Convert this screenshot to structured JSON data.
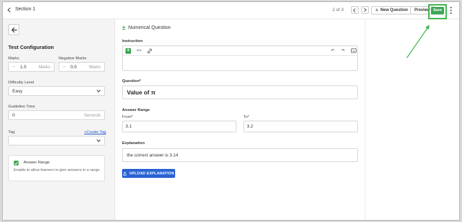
{
  "header": {
    "section_label": "Section 1",
    "page_indicator": "2 of 3",
    "new_question_label": "New Question",
    "preview_label": "Preview",
    "save_label": "Save"
  },
  "sidebar": {
    "title": "Test Configuration",
    "marks": {
      "label": "Marks",
      "value": "1.0",
      "unit": "Marks"
    },
    "negative_marks": {
      "label": "Negative Marks",
      "value": "0.0",
      "unit": "Marks"
    },
    "difficulty": {
      "label": "Difficulty Level",
      "value": "Easy"
    },
    "guideline_time": {
      "label": "Guideline Time",
      "value": "0",
      "unit": "Seconds"
    },
    "tag": {
      "label": "Tag",
      "value": "",
      "create_link": "+Create Tag"
    },
    "answer_range": {
      "checked": true,
      "label": "Answer Range",
      "description": "Enable to allow learners to give answers in a range"
    }
  },
  "main": {
    "question_type": "Numerical Question",
    "instruction_label": "Instruction",
    "question_label": "Question*",
    "question_text": "Value of π",
    "answer_range_label": "Answer Range",
    "from_label": "From*",
    "from_value": "3.1",
    "to_label": "To*",
    "to_value": "3.2",
    "explanation_label": "Explanation",
    "explanation_text": "the correct answer is 3.14",
    "upload_label": "UPLOAD EXPLANATION"
  },
  "colors": {
    "accent_green": "#3ea655",
    "primary_blue": "#2a63d4",
    "link_blue": "#2557d6"
  }
}
